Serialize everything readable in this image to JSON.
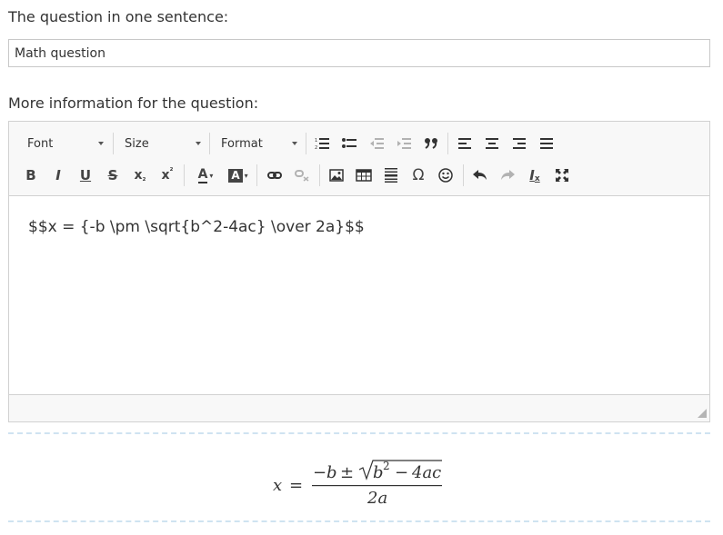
{
  "question_label": "The question in one sentence:",
  "question_value": "Math question",
  "more_label": "More information for the question:",
  "toolbar": {
    "font_label": "Font",
    "size_label": "Size",
    "format_label": "Format",
    "icons_row1": [
      "numbered-list-icon",
      "bulleted-list-icon",
      "decrease-indent-icon",
      "increase-indent-icon",
      "blockquote-icon",
      "align-left-icon",
      "align-center-icon",
      "align-right-icon",
      "align-justify-icon"
    ],
    "icons_row2": [
      "bold-icon",
      "italic-icon",
      "underline-icon",
      "strikethrough-icon",
      "subscript-icon",
      "superscript-icon",
      "text-color-icon",
      "background-color-icon",
      "link-icon",
      "unlink-icon",
      "image-icon",
      "table-icon",
      "horizontal-line-icon",
      "special-character-icon",
      "smiley-icon",
      "undo-icon",
      "redo-icon",
      "remove-format-icon",
      "maximize-icon"
    ],
    "bold": "B",
    "italic": "I",
    "underline": "U",
    "strike": "S",
    "subscript": "x",
    "subscript_sub": "₂",
    "superscript": "x",
    "superscript_sup": "²",
    "text_color": "A",
    "bg_color": "A",
    "omega": "Ω",
    "clear_format": "I",
    "clear_format_sub": "x"
  },
  "editor_content": "$$x = {-b \\pm \\sqrt{b^2-4ac} \\over 2a}$$",
  "preview": {
    "lhs": "x",
    "equals": "=",
    "minus": "−",
    "b": "b",
    "pm": "±",
    "radicand_b": "b",
    "exponent": "2",
    "radicand_rest": "4ac",
    "inner_minus": "−",
    "denominator": "2a"
  },
  "colors": {
    "editor_border": "#d1d1d1",
    "toolbar_bg": "#f8f8f8",
    "dash": "#cfe3f1",
    "text": "#333333"
  }
}
